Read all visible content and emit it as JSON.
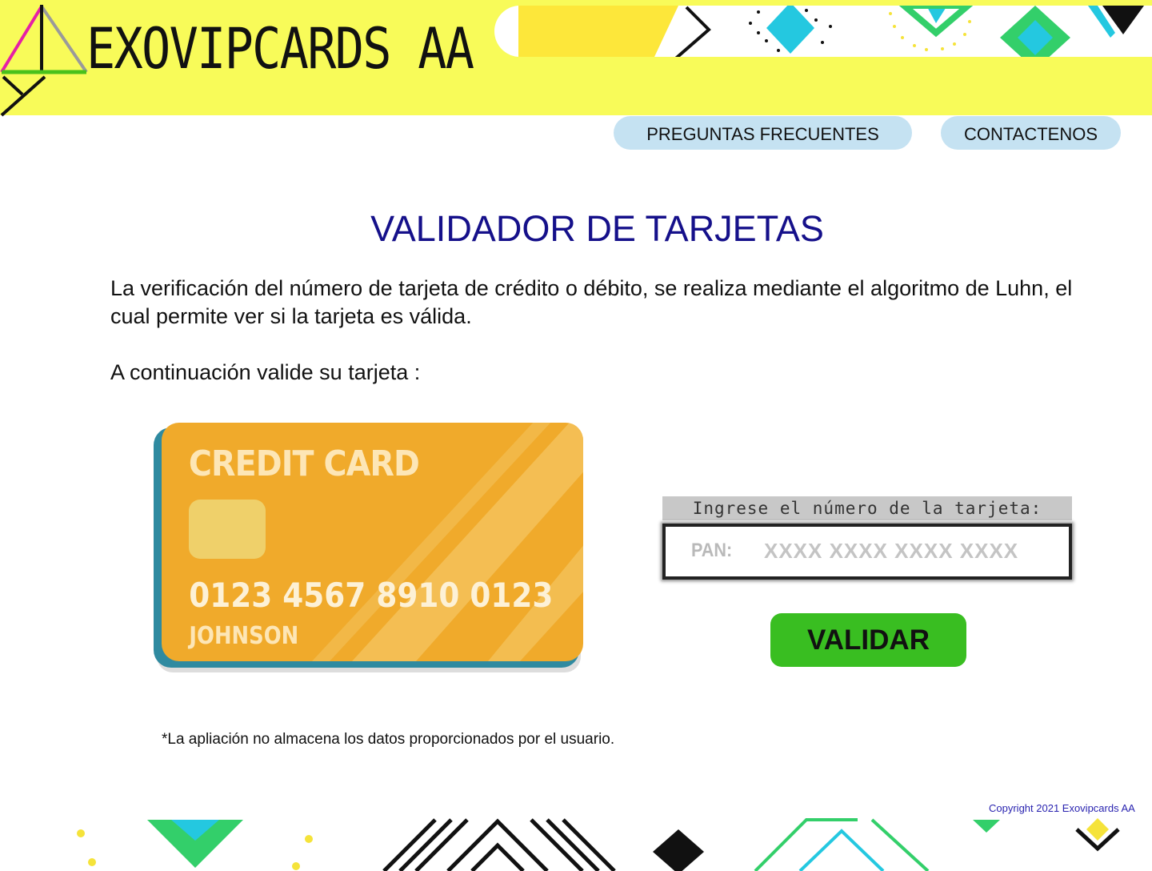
{
  "header": {
    "brand": "EXOVIPCARDS AA"
  },
  "nav": {
    "faq_label": "PREGUNTAS FRECUENTES",
    "contact_label": "CONTACTENOS"
  },
  "main": {
    "title": "VALIDADOR DE TARJETAS",
    "intro": "La verificación del número de tarjeta de crédito o débito, se realiza mediante el algoritmo de Luhn, el cual permite ver si la tarjeta es válida.",
    "prompt": "A continuación valide su tarjeta :"
  },
  "card": {
    "heading": "CREDIT CARD",
    "number": "0123 4567 8910 0123",
    "holder": "JOHNSON"
  },
  "form": {
    "field_label": "Ingrese el número de la tarjeta:",
    "pan_label": "PAN:",
    "pan_value": "",
    "pan_placeholder": "XXXX XXXX XXXX XXXX",
    "validate_label": "VALIDAR"
  },
  "disclaimer": "*La apliación no almacena los datos proporcionados por el usuario.",
  "footer": {
    "copyright": "Copyright 2021 Exovipcards  AA"
  },
  "colors": {
    "header_bg": "#f8fb59",
    "nav_bg": "#c5e2f2",
    "title": "#15108a",
    "validate_button": "#39be21",
    "card_gold": "#f0aa2b",
    "card_teal": "#2f8aa0",
    "copyright": "#2a24b0"
  },
  "icons": [
    "logo-icon",
    "credit-card-illustration",
    "decorative-pattern"
  ]
}
